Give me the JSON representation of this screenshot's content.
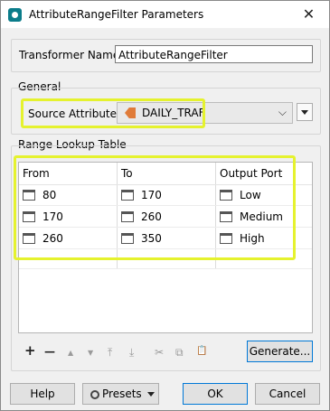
{
  "window": {
    "title": "AttributeRangeFilter Parameters",
    "close_glyph": "✕"
  },
  "transformer_name": {
    "label": "Transformer Name:",
    "value": "AttributeRangeFilter"
  },
  "general": {
    "group_label": "General",
    "source_attribute_label": "Source Attribute:",
    "source_attribute_value": "DAILY_TRAF"
  },
  "range_table": {
    "group_label": "Range Lookup Table",
    "columns": [
      "From",
      "To",
      "Output Port"
    ],
    "rows": [
      {
        "from": "80",
        "to": "170",
        "port": "Low"
      },
      {
        "from": "170",
        "to": "260",
        "port": "Medium"
      },
      {
        "from": "260",
        "to": "350",
        "port": "High"
      }
    ]
  },
  "toolbar": {
    "add": "+",
    "remove": "—",
    "up": "▲",
    "down": "▼",
    "top": "⤒",
    "bottom": "⤓",
    "cut": "✂",
    "copy": "⧉",
    "paste": "📋",
    "generate_label": "Generate..."
  },
  "footer": {
    "help": "Help",
    "presets": "Presets",
    "ok": "OK",
    "cancel": "Cancel"
  },
  "colors": {
    "highlight": "#e5f22e",
    "accent": "#0078d7",
    "attribute_icon": "#e07b39"
  }
}
